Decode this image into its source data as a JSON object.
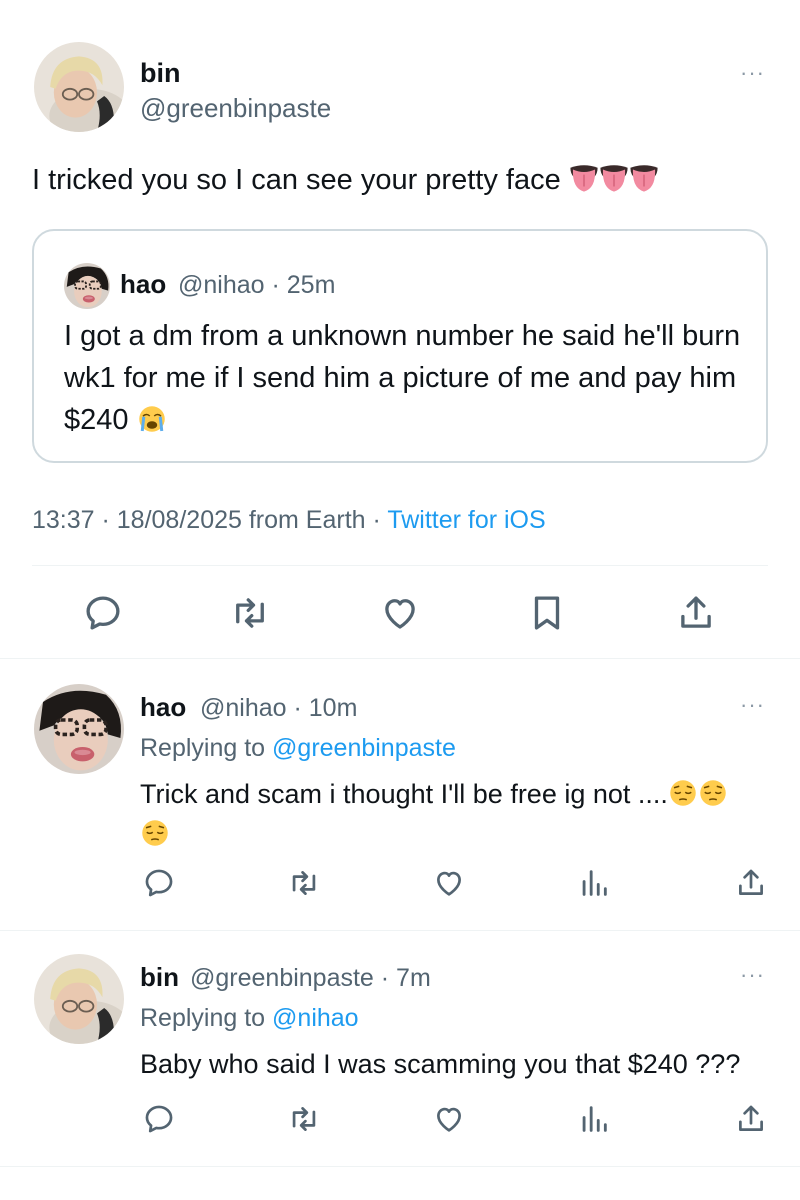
{
  "main_tweet": {
    "author_name": "bin",
    "author_handle": "@greenbinpaste",
    "text": "I tricked you so I can see your pretty face",
    "emoji_icons": [
      "tongue-emoji",
      "tongue-emoji",
      "tongue-emoji"
    ],
    "quoted_tweet": {
      "author_name": "hao",
      "meta": "@nihao · 25m",
      "text": "I got a dm from a unknown number he said he'll burn wk1 for me if I send him a picture of me and pay him $240",
      "emoji_icon": "loudly-crying-emoji"
    },
    "timestamp": "13:37 · 18/08/2025 from Earth · ",
    "source": "Twitter for iOS",
    "actions": [
      "reply-icon",
      "retweet-icon",
      "like-icon",
      "bookmark-icon",
      "share-icon"
    ]
  },
  "replies": [
    {
      "author_name": "hao",
      "meta": "@nihao · 10m",
      "replying_label": "Replying to ",
      "replying_to": "@greenbinpaste",
      "text": "Trick and scam i thought I'll be free ig not ....",
      "emoji_icon": "pensive-emoji"
    },
    {
      "author_name": "bin",
      "meta": "@greenbinpaste · 7m",
      "replying_label": "Replying to ",
      "replying_to": "@nihao",
      "text": "Baby who said I was scamming you that $240 ???"
    }
  ],
  "more_label": "···",
  "colors": {
    "text": "#0f1419",
    "secondary": "#536471",
    "link": "#1d9bf0",
    "border": "#cfd9de",
    "divider": "#eff3f4"
  }
}
